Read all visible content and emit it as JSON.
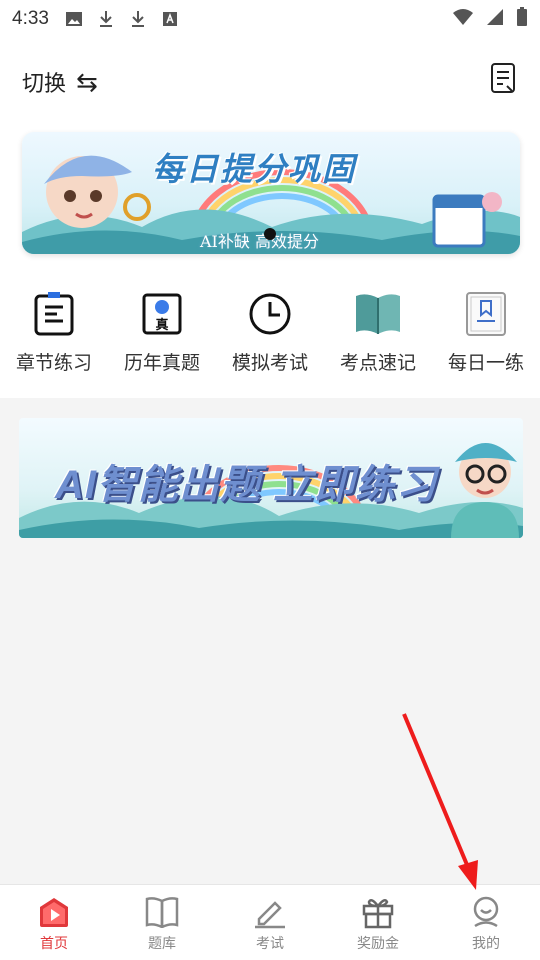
{
  "status_bar": {
    "time": "4:33"
  },
  "header": {
    "switch_label": "切换",
    "switch_icon": "⇆"
  },
  "banner_top": {
    "title": "每日提分巩固",
    "subtitle": "AI补缺 高效提分"
  },
  "shortcuts": [
    {
      "label": "章节练习",
      "icon": "chapter-list-icon"
    },
    {
      "label": "历年真题",
      "icon": "past-exam-icon"
    },
    {
      "label": "模拟考试",
      "icon": "clock-icon"
    },
    {
      "label": "考点速记",
      "icon": "open-book-icon"
    },
    {
      "label": "每日一练",
      "icon": "bookmark-icon"
    }
  ],
  "banner_ai": {
    "title": "AI智能出题 立即练习"
  },
  "tabbar": [
    {
      "label": "首页",
      "icon": "home-play-icon",
      "active": true
    },
    {
      "label": "题库",
      "icon": "book-icon",
      "active": false
    },
    {
      "label": "考试",
      "icon": "pencil-icon",
      "active": false
    },
    {
      "label": "奖励金",
      "icon": "gift-icon",
      "active": false
    },
    {
      "label": "我的",
      "icon": "profile-icon",
      "active": false
    }
  ],
  "colors": {
    "accent": "#e0383b",
    "banner_blue": "#2f7fc2",
    "tab_inactive": "#888888"
  }
}
